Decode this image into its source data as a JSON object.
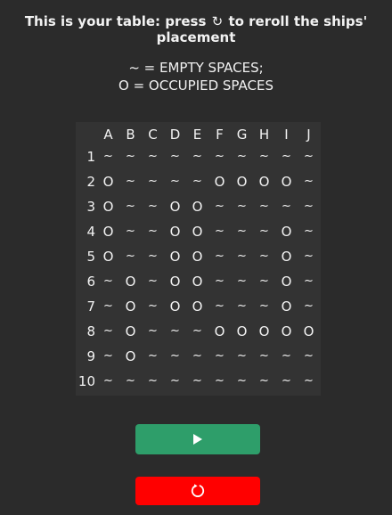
{
  "header": {
    "text_before": "This is your table: press ",
    "reroll_glyph": "↻",
    "text_after": " to reroll the ships' placement"
  },
  "legend": {
    "line1": "~ = EMPTY SPACES;",
    "line2": "O = OCCUPIED SPACES"
  },
  "board": {
    "columns": [
      "A",
      "B",
      "C",
      "D",
      "E",
      "F",
      "G",
      "H",
      "I",
      "J"
    ],
    "rows": [
      {
        "label": "1",
        "cells": [
          "~",
          "~",
          "~",
          "~",
          "~",
          "~",
          "~",
          "~",
          "~",
          "~"
        ]
      },
      {
        "label": "2",
        "cells": [
          "O",
          "~",
          "~",
          "~",
          "~",
          "O",
          "O",
          "O",
          "O",
          "~"
        ]
      },
      {
        "label": "3",
        "cells": [
          "O",
          "~",
          "~",
          "O",
          "O",
          "~",
          "~",
          "~",
          "~",
          "~"
        ]
      },
      {
        "label": "4",
        "cells": [
          "O",
          "~",
          "~",
          "O",
          "O",
          "~",
          "~",
          "~",
          "O",
          "~"
        ]
      },
      {
        "label": "5",
        "cells": [
          "O",
          "~",
          "~",
          "O",
          "O",
          "~",
          "~",
          "~",
          "O",
          "~"
        ]
      },
      {
        "label": "6",
        "cells": [
          "~",
          "O",
          "~",
          "O",
          "O",
          "~",
          "~",
          "~",
          "O",
          "~"
        ]
      },
      {
        "label": "7",
        "cells": [
          "~",
          "O",
          "~",
          "O",
          "O",
          "~",
          "~",
          "~",
          "O",
          "~"
        ]
      },
      {
        "label": "8",
        "cells": [
          "~",
          "O",
          "~",
          "~",
          "~",
          "O",
          "O",
          "O",
          "O",
          "O"
        ]
      },
      {
        "label": "9",
        "cells": [
          "~",
          "O",
          "~",
          "~",
          "~",
          "~",
          "~",
          "~",
          "~",
          "~"
        ]
      },
      {
        "label": "10",
        "cells": [
          "~",
          "~",
          "~",
          "~",
          "~",
          "~",
          "~",
          "~",
          "~",
          "~"
        ]
      }
    ]
  },
  "buttons": {
    "play_icon": "play-icon",
    "reroll_icon": "reroll-icon"
  },
  "colors": {
    "background": "#2b2b2b",
    "board": "#333333",
    "play_button": "#2e9e6a",
    "reroll_button": "#ff0000"
  }
}
